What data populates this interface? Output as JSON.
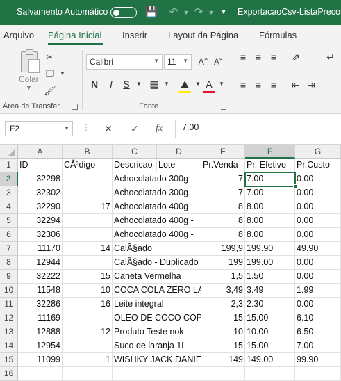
{
  "titlebar": {
    "autosave_label": "Salvamento Automático",
    "filename": "ExportacaoCsv-ListaPreco"
  },
  "ribbon_tabs": [
    "Arquivo",
    "Página Inicial",
    "Inserir",
    "Layout da Página",
    "Fórmulas"
  ],
  "ribbon": {
    "paste_label": "Colar",
    "clipboard_group": "Área de Transfer...",
    "font_group": "Fonte",
    "font_name": "Calibri",
    "font_size": "11",
    "bold": "N",
    "italic": "I",
    "underline": "S",
    "accent_color": "#217346",
    "font_color": "#e81123",
    "highlight_color": "#ffee00"
  },
  "formula_bar": {
    "name_box": "F2",
    "value": "7.00",
    "fx_label": "fx",
    "cancel": "✕",
    "enter": "✓"
  },
  "grid": {
    "columns": [
      "A",
      "B",
      "C",
      "D",
      "E",
      "F",
      "G"
    ],
    "selected_column": "F",
    "selected_row": "2",
    "rows": [
      {
        "n": "1",
        "cells": [
          "ID",
          "CÃ³digo",
          "Descricao",
          "Lote",
          "Pr.Venda",
          "Pr. Efetivo",
          "Pr.Custo"
        ]
      },
      {
        "n": "2",
        "cells": [
          "32298",
          "",
          "Achocolatado 300g",
          "",
          "7",
          "7.00",
          "0.00"
        ]
      },
      {
        "n": "3",
        "cells": [
          "32302",
          "",
          "Achocolatado 300g",
          "",
          "7",
          "7.00",
          "0.00"
        ]
      },
      {
        "n": "4",
        "cells": [
          "32290",
          "17",
          "Achocolatado 400g",
          "",
          "8",
          "8.00",
          "0.00"
        ]
      },
      {
        "n": "5",
        "cells": [
          "32294",
          "",
          "Achocolatado 400g - ",
          "",
          "8",
          "8.00",
          "0.00"
        ]
      },
      {
        "n": "6",
        "cells": [
          "32306",
          "",
          "Achocolatado 400g - ",
          "",
          "8",
          "8.00",
          "0.00"
        ]
      },
      {
        "n": "7",
        "cells": [
          "11170",
          "14",
          "CalÃ§ado",
          "",
          "199,9",
          "199.90",
          "49.90"
        ]
      },
      {
        "n": "8",
        "cells": [
          "12944",
          "",
          "CalÃ§ado - Duplicado",
          "",
          "199",
          "199.00",
          "0.00"
        ]
      },
      {
        "n": "9",
        "cells": [
          "32222",
          "15",
          "Caneta Vermelha",
          "",
          "1,5",
          "1.50",
          "0.00"
        ]
      },
      {
        "n": "10",
        "cells": [
          "11548",
          "10",
          "COCA COLA ZERO LAT",
          "",
          "3,49",
          "3.49",
          "1.99"
        ]
      },
      {
        "n": "11",
        "cells": [
          "32286",
          "16",
          "Leite integral",
          "",
          "2,3",
          "2.30",
          "0.00"
        ]
      },
      {
        "n": "12",
        "cells": [
          "11169",
          "",
          "OLEO DE COCO COPR",
          "",
          "15",
          "15.00",
          "6.10"
        ]
      },
      {
        "n": "13",
        "cells": [
          "12888",
          "12",
          "Produto Teste nok",
          "",
          "10",
          "10.00",
          "6.50"
        ]
      },
      {
        "n": "14",
        "cells": [
          "12954",
          "",
          "Suco de laranja 1L",
          "",
          "15",
          "15.00",
          "7.00"
        ]
      },
      {
        "n": "15",
        "cells": [
          "11099",
          "1",
          "WISHKY JACK DANIEL",
          "",
          "149",
          "149.00",
          "99.90"
        ]
      },
      {
        "n": "16",
        "cells": [
          "",
          "",
          "",
          "",
          "",
          "",
          ""
        ]
      }
    ]
  }
}
